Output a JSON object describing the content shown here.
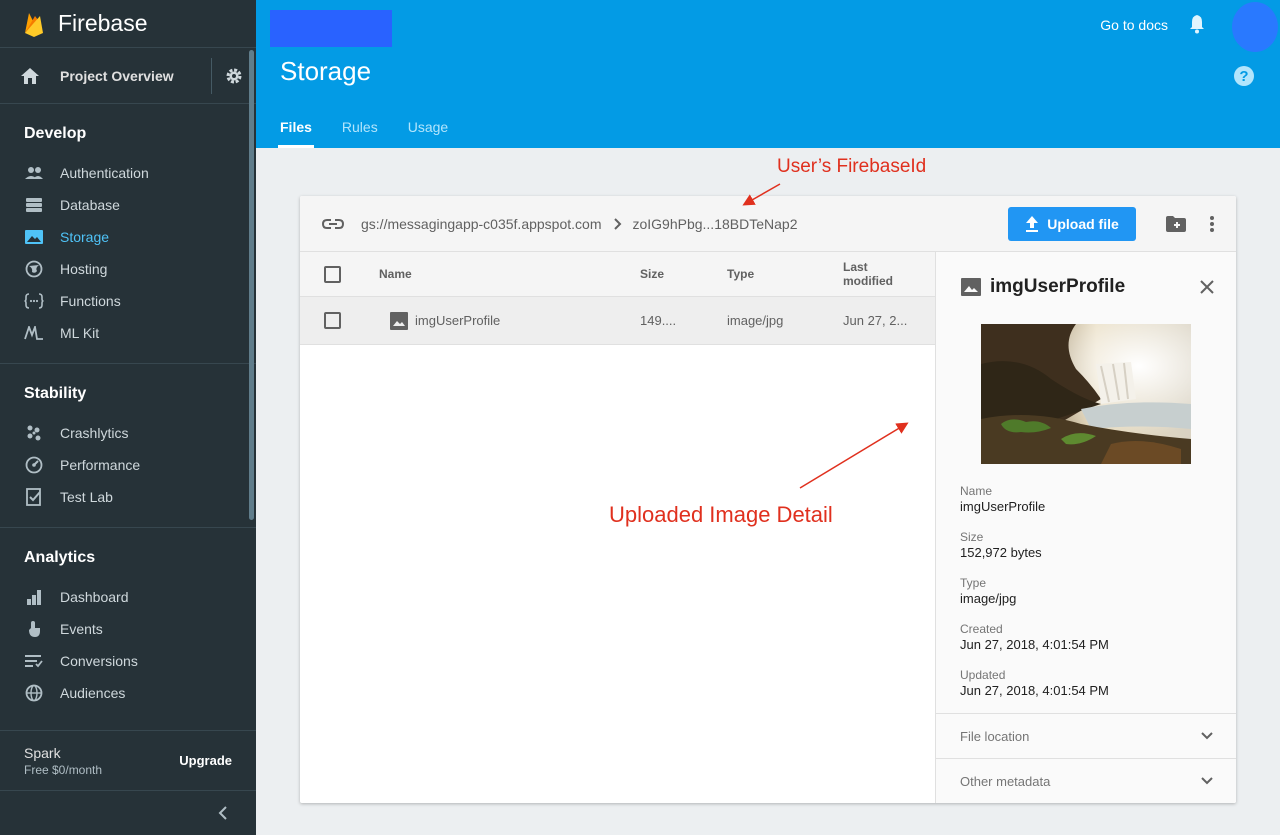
{
  "sidebar": {
    "brand": "Firebase",
    "overview": "Project Overview",
    "sections": [
      {
        "title": "Develop",
        "items": [
          "Authentication",
          "Database",
          "Storage",
          "Hosting",
          "Functions",
          "ML Kit"
        ]
      },
      {
        "title": "Stability",
        "items": [
          "Crashlytics",
          "Performance",
          "Test Lab"
        ]
      },
      {
        "title": "Analytics",
        "items": [
          "Dashboard",
          "Events",
          "Conversions",
          "Audiences"
        ]
      }
    ],
    "active_item": "Storage",
    "plan": {
      "name": "Spark",
      "price": "Free $0/month",
      "upgrade": "Upgrade"
    }
  },
  "header": {
    "docs_link": "Go to docs",
    "page_title": "Storage",
    "tabs": [
      "Files",
      "Rules",
      "Usage"
    ],
    "active_tab": "Files",
    "help": "?"
  },
  "toolbar": {
    "bucket": "gs://messagingapp-c035f.appspot.com",
    "folder": "zoIG9hPbg...18BDTeNap2",
    "upload_label": "Upload file"
  },
  "table": {
    "columns": {
      "name": "Name",
      "size": "Size",
      "type": "Type",
      "modified_line1": "Last",
      "modified_line2": "modified"
    },
    "rows": [
      {
        "name": "imgUserProfile",
        "size": "149....",
        "type": "image/jpg",
        "modified": "Jun 27, 2..."
      }
    ]
  },
  "detail": {
    "title": "imgUserProfile",
    "props": [
      {
        "key": "Name",
        "value": "imgUserProfile"
      },
      {
        "key": "Size",
        "value": "152,972 bytes"
      },
      {
        "key": "Type",
        "value": "image/jpg"
      },
      {
        "key": "Created",
        "value": "Jun 27, 2018, 4:01:54 PM"
      },
      {
        "key": "Updated",
        "value": "Jun 27, 2018, 4:01:54 PM"
      }
    ],
    "file_location": "File location",
    "other_metadata": "Other metadata"
  },
  "annotations": {
    "user_id": "User’s FirebaseId",
    "image_detail": "Uploaded Image Detail"
  },
  "colors": {
    "sidebar_bg": "#263238",
    "header_bg": "#039be5",
    "active_nav": "#4fc3f7",
    "upload_button": "#2196f3",
    "annotation": "#e0301e"
  }
}
